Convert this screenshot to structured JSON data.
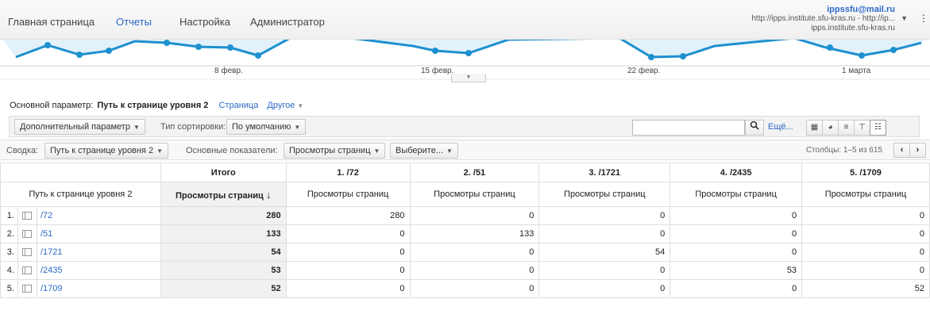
{
  "nav": {
    "items": [
      {
        "label": "Главная страница",
        "active": false
      },
      {
        "label": "Отчеты",
        "active": true
      },
      {
        "label": "Настройка",
        "active": false
      },
      {
        "label": "Администратор",
        "active": false
      }
    ]
  },
  "account": {
    "email": "ippssfu@mail.ru",
    "property": "http://ipps.institute.sfu-kras.ru - http://ip...",
    "site": "ipps.institute.sfu-kras.ru"
  },
  "chart": {
    "x_labels": [
      "8 февр.",
      "15 февр.",
      "22 февр.",
      "1 марта"
    ],
    "line_color": "#1e90cf",
    "fill_color": "#e3f1fa"
  },
  "dimension": {
    "label": "Основной параметр:",
    "current": "Путь к странице уровня 2",
    "link1": "Страница",
    "link2": "Другое"
  },
  "toolbar": {
    "secondary_dim": "Дополнительный параметр",
    "sort_label": "Тип сортировки:",
    "sort_value": "По умолчанию",
    "search_placeholder": "",
    "more": "Ещё..."
  },
  "summary": {
    "label": "Сводка:",
    "dim_value": "Путь к странице уровня 2",
    "metrics_label": "Основные показатели:",
    "metric_value": "Просмотры страниц",
    "select_value": "Выберите...",
    "columns_info": "Столбцы:  1–5 из 615"
  },
  "table": {
    "header": [
      "Итого",
      "1. /72",
      "2. /51",
      "3. /1721",
      "4. /2435",
      "5. /1709"
    ],
    "dim_header": "Путь к странице уровня 2",
    "sub": [
      "Просмотры страниц",
      "Просмотры страниц",
      "Просмотры страниц",
      "Просмотры страниц",
      "Просмотры страниц",
      "Просмотры страниц"
    ],
    "rows": [
      {
        "idx": "1.",
        "name": "/72",
        "vals": [
          "280",
          "280",
          "0",
          "0",
          "0",
          "0"
        ]
      },
      {
        "idx": "2.",
        "name": "/51",
        "vals": [
          "133",
          "0",
          "133",
          "0",
          "0",
          "0"
        ]
      },
      {
        "idx": "3.",
        "name": "/1721",
        "vals": [
          "54",
          "0",
          "0",
          "54",
          "0",
          "0"
        ]
      },
      {
        "idx": "4.",
        "name": "/2435",
        "vals": [
          "53",
          "0",
          "0",
          "0",
          "53",
          "0"
        ]
      },
      {
        "idx": "5.",
        "name": "/1709",
        "vals": [
          "52",
          "0",
          "0",
          "0",
          "0",
          "52"
        ]
      }
    ]
  }
}
